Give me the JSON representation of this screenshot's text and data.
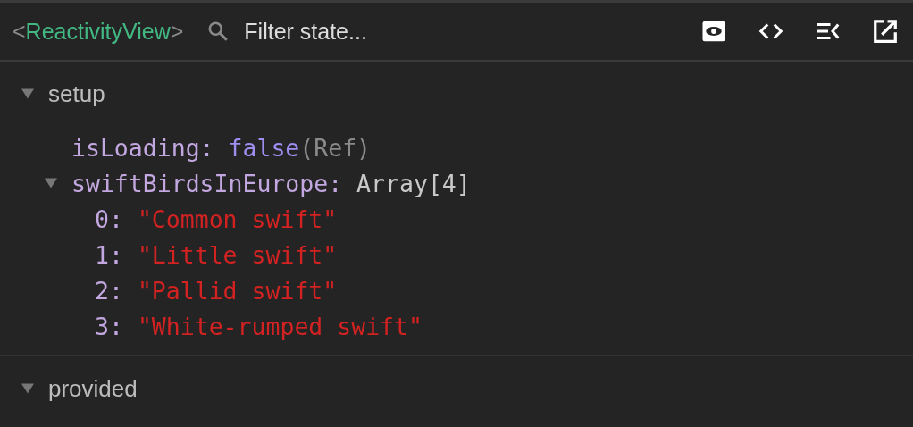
{
  "toolbar": {
    "component": {
      "open": "<",
      "name": "ReactivityView",
      "close": ">"
    },
    "search": {
      "placeholder": "Filter state..."
    }
  },
  "sections": [
    {
      "title": "setup",
      "expanded": true,
      "props": [
        {
          "kind": "value",
          "key": "isLoading:",
          "value": "false",
          "note": "(Ref)"
        },
        {
          "kind": "array",
          "key": "swiftBirdsInEurope:",
          "summary": "Array[4]",
          "expanded": true,
          "children": [
            {
              "key": "0:",
              "value": "\"Common swift\""
            },
            {
              "key": "1:",
              "value": "\"Little swift\""
            },
            {
              "key": "2:",
              "value": "\"Pallid swift\""
            },
            {
              "key": "3:",
              "value": "\"White-rumped swift\""
            }
          ]
        }
      ]
    },
    {
      "title": "provided",
      "expanded": true
    }
  ]
}
